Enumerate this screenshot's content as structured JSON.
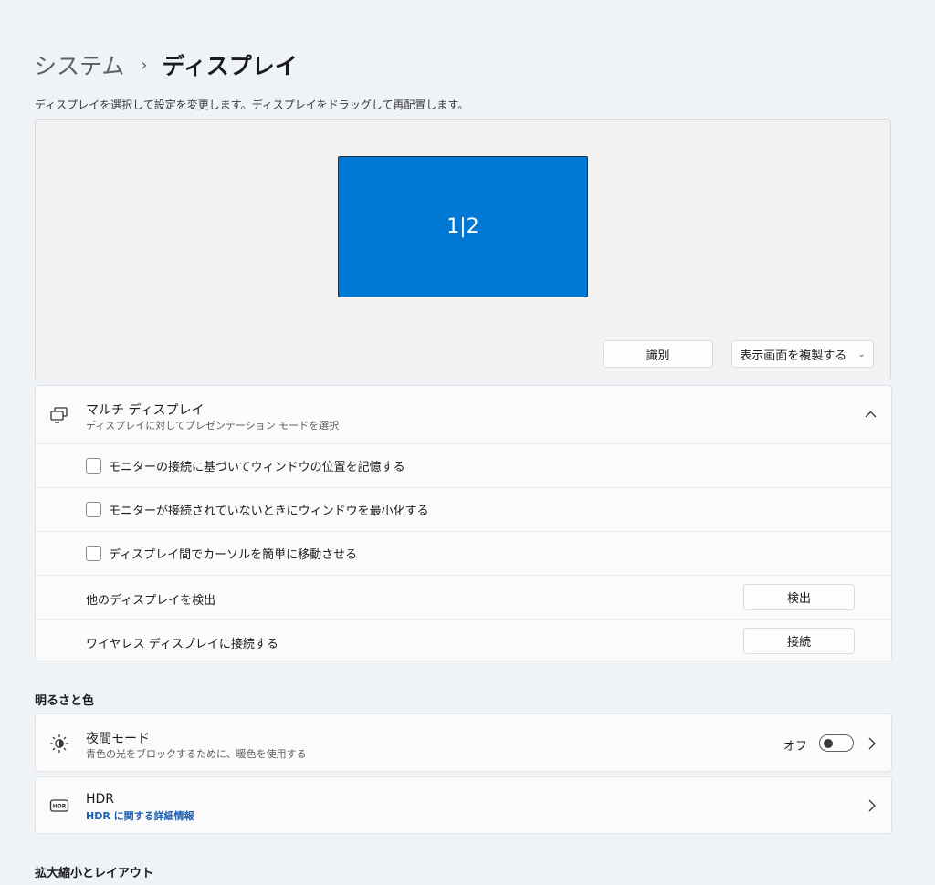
{
  "breadcrumb": {
    "parent": "システム",
    "separator": "›",
    "current": "ディスプレイ"
  },
  "description": "ディスプレイを選択して設定を変更します。ディスプレイをドラッグして再配置します。",
  "arrangement": {
    "monitor_label": "1|2",
    "monitor_color": "#0078d4",
    "identify_button": "識別",
    "mode_dropdown": {
      "selected": "表示画面を複製する"
    }
  },
  "multi_display": {
    "icon": "multi-display-icon",
    "title": "マルチ ディスプレイ",
    "subtitle": "ディスプレイに対してプレゼンテーション モードを選択",
    "expanded": true,
    "checkboxes": [
      {
        "label": "モニターの接続に基づいてウィンドウの位置を記憶する",
        "checked": false
      },
      {
        "label": "モニターが接続されていないときにウィンドウを最小化する",
        "checked": false
      },
      {
        "label": "ディスプレイ間でカーソルを簡単に移動させる",
        "checked": false
      }
    ],
    "detect": {
      "label": "他のディスプレイを検出",
      "button": "検出"
    },
    "wireless": {
      "label": "ワイヤレス ディスプレイに接続する",
      "button": "接続"
    }
  },
  "brightness_section": {
    "heading": "明るさと色",
    "night_light": {
      "icon": "night-light-icon",
      "title": "夜間モード",
      "subtitle": "青色の光をブロックするために、暖色を使用する",
      "state_label": "オフ",
      "on": false
    },
    "hdr": {
      "icon": "hdr-icon",
      "title": "HDR",
      "link": "HDR に関する詳細情報"
    }
  },
  "scale_section": {
    "heading": "拡大縮小とレイアウト"
  },
  "colors": {
    "accent": "#0078d4",
    "link": "#1b5fb0",
    "background": "#eff3f8"
  }
}
